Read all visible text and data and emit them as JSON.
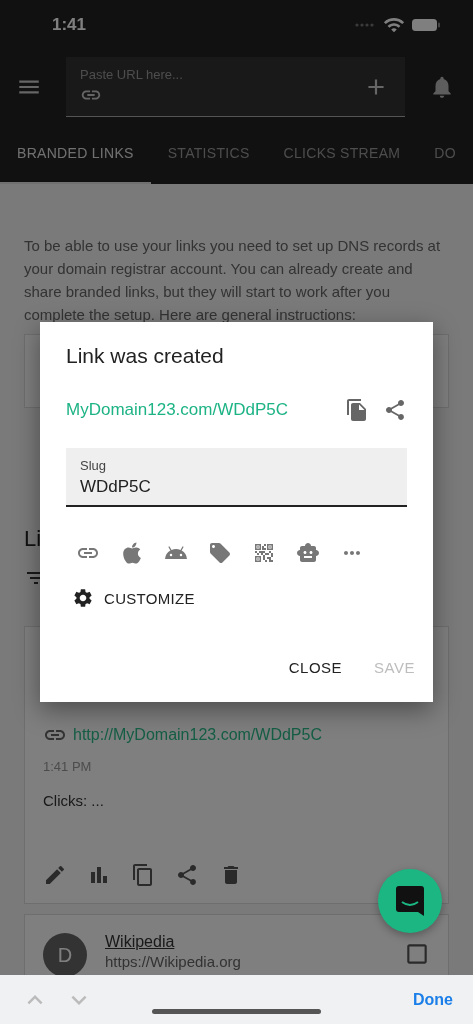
{
  "status_bar": {
    "time": "1:41"
  },
  "app_bar": {
    "url_field": {
      "placeholder": "Paste URL here..."
    }
  },
  "tabs": [
    {
      "label": "BRANDED LINKS",
      "selected": true
    },
    {
      "label": "STATISTICS",
      "selected": false
    },
    {
      "label": "CLICKS STREAM",
      "selected": false
    },
    {
      "label": "DO",
      "selected": false
    }
  ],
  "notice": {
    "text": "To be able to use your links you need to set up DNS records at your domain registrar account. You can already create and share branded links, but they will start to work after you complete the setup. Here are general instructions:"
  },
  "links_heading": "Li",
  "link_cards": [
    {
      "kind": "link",
      "url": "http://MyDomain123.com/WDdP5C",
      "time": "1:41 PM",
      "clicks": "Clicks: ..."
    },
    {
      "kind": "site",
      "avatar": "D",
      "title": "Wikipedia",
      "url": "https://Wikipedia.org",
      "checked": false
    }
  ],
  "dialog": {
    "title": "Link was created",
    "short_link": "MyDomain123.com/WDdP5C",
    "slug": {
      "label": "Slug",
      "value": "WDdP5C"
    },
    "customize": "CUSTOMIZE",
    "buttons": [
      {
        "label": "CLOSE",
        "disabled": false
      },
      {
        "label": "SAVE",
        "disabled": true
      }
    ]
  },
  "keyboard_bar": {
    "done": "Done"
  }
}
